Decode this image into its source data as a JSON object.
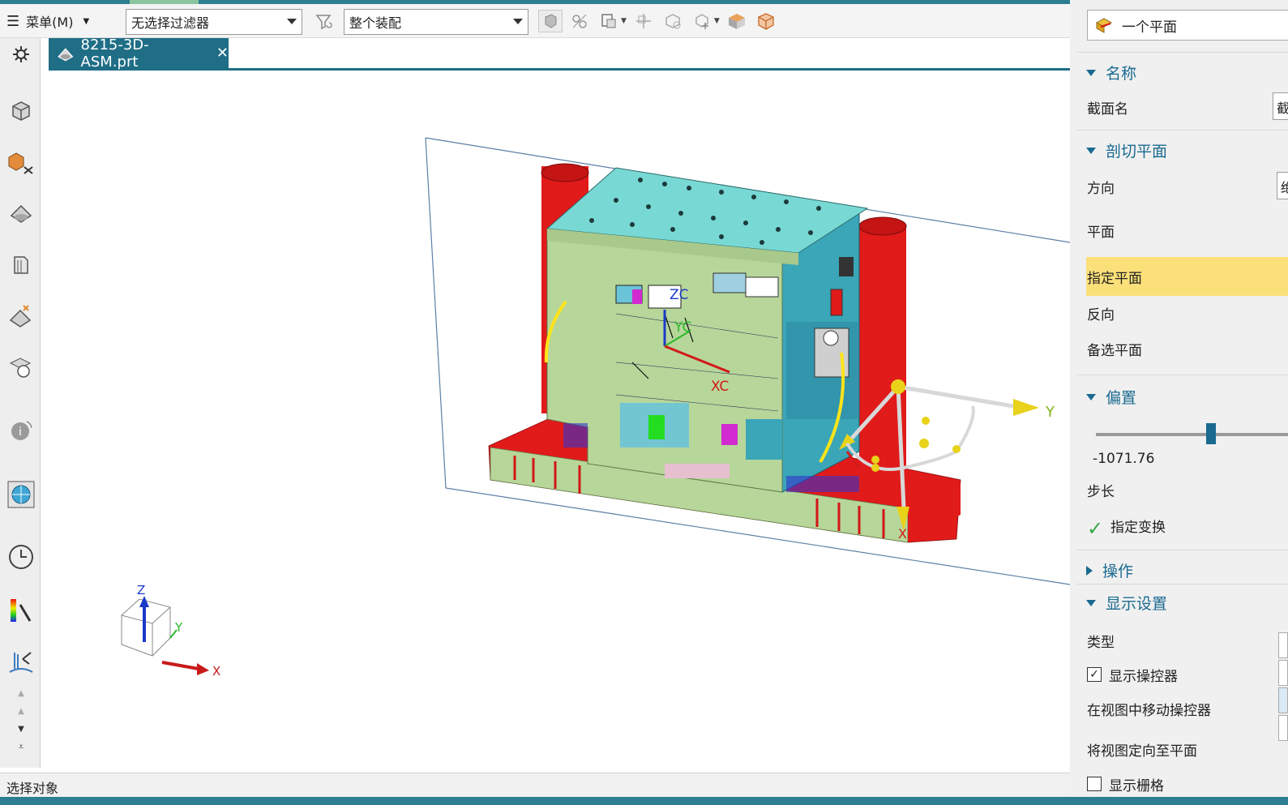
{
  "toolbar": {
    "menu_label": "菜单(M)",
    "filter_value": "无选择过滤器",
    "scope_value": "整个装配"
  },
  "tab": {
    "title": "8215-3D-ASM.prt",
    "close_glyph": "✕"
  },
  "viewport": {
    "wcs_labels": {
      "zc": "ZC",
      "yc": "YC",
      "xc": "XC"
    },
    "manipulator_labels": {
      "y": "Y",
      "x": "X"
    },
    "triad_labels": {
      "z": "Z",
      "y": "Y",
      "x": "X"
    }
  },
  "status": {
    "prompt": "选择对象"
  },
  "panel": {
    "type_value": "一个平面",
    "sections": {
      "name": "名称",
      "cut_plane": "剖切平面",
      "offset": "偏置",
      "operations": "操作",
      "display_settings": "显示设置"
    },
    "labels": {
      "section_name": "截面名",
      "direction": "方向",
      "plane": "平面",
      "specify_plane": "指定平面",
      "reverse": "反向",
      "alt_plane": "备选平面",
      "offset_value": "-1071.76",
      "step": "步长",
      "specify_transform": "指定变换",
      "type": "类型",
      "show_manipulator": "显示操控器",
      "move_manipulator": "在视图中移动操控器",
      "orient_view": "将视图定向至平面",
      "show_grid": "显示栅格"
    },
    "fields": {
      "section_name_value": "截",
      "direction_value": "绝"
    },
    "checkboxes": {
      "show_manipulator": true,
      "show_grid": false
    },
    "offset_slider_fraction": 0.6
  },
  "colors": {
    "accent": "#1f6e86",
    "section_header": "#1a6a90",
    "highlight": "#fbe07a",
    "mold_green": "#b7d69a",
    "mold_cyan": "#78d8d4",
    "mold_red": "#e11a1a"
  }
}
